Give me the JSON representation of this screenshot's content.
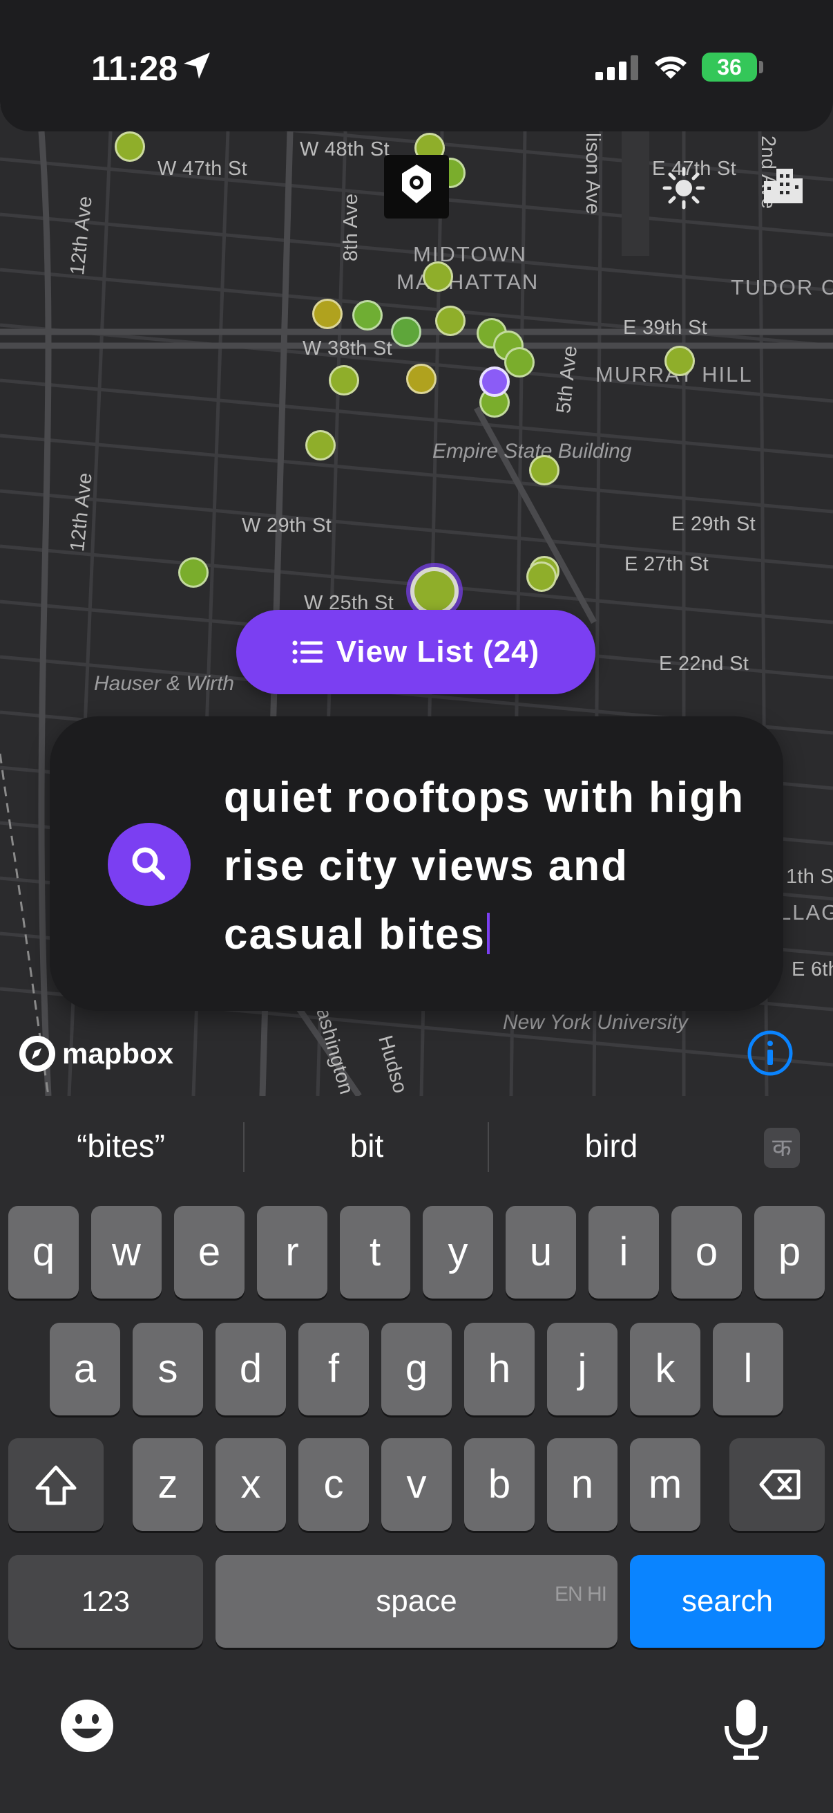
{
  "status_bar": {
    "time": "11:28",
    "battery": "36"
  },
  "map": {
    "streets": [
      "W 47th St",
      "W 48th St",
      "12th Ave",
      "8th Ave",
      "lison Ave",
      "E 47th St",
      "2nd Ave",
      "W 38th St",
      "E 39th St",
      "5th Ave",
      "12th Ave",
      "W 29th St",
      "E 29th St",
      "E 27th St",
      "W 25th St",
      "E 22nd St",
      "1th S",
      "E 6th",
      "ashington",
      "Hudso"
    ],
    "areas": [
      "MIDTOWN",
      "MANHATTAN",
      "TUDOR C",
      "MURRAY HILL",
      "LLAG"
    ],
    "pois": [
      "Empire State Building",
      "Hauser & Wirth",
      "New York University"
    ],
    "attribution": "mapbox"
  },
  "view_list_label": "View List (24)",
  "search": {
    "query": "quiet rooftops with high rise city views and casual bites"
  },
  "keyboard": {
    "suggestions": [
      "“bites”",
      "bit",
      "bird"
    ],
    "row1": [
      "q",
      "w",
      "e",
      "r",
      "t",
      "y",
      "u",
      "i",
      "o",
      "p"
    ],
    "row2": [
      "a",
      "s",
      "d",
      "f",
      "g",
      "h",
      "j",
      "k",
      "l"
    ],
    "row3": [
      "z",
      "x",
      "c",
      "v",
      "b",
      "n",
      "m"
    ],
    "numbers_label": "123",
    "space_label": "space",
    "language_label": "EN HI",
    "search_label": "search",
    "hindi_label": "क"
  },
  "colors": {
    "accent": "#7b3ff2",
    "search_key": "#0a84ff",
    "battery": "#34c759",
    "info": "#0a84ff"
  }
}
